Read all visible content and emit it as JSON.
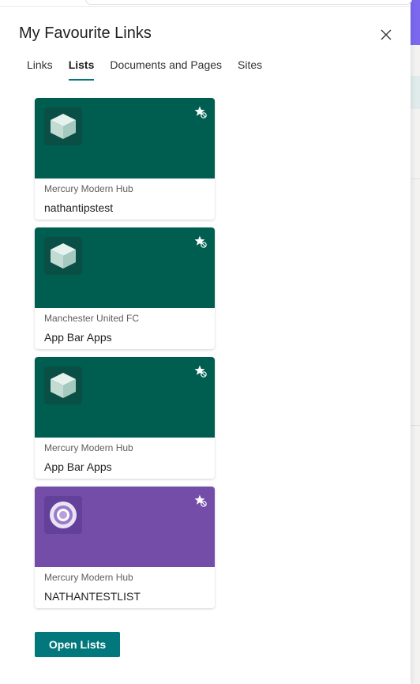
{
  "panel": {
    "title": "My Favourite Links",
    "close_label": "close"
  },
  "tabs": [
    {
      "label": "Links",
      "active": false
    },
    {
      "label": "Lists",
      "active": true
    },
    {
      "label": "Documents and Pages",
      "active": false
    },
    {
      "label": "Sites",
      "active": false
    }
  ],
  "cards": [
    {
      "site": "Mercury Modern Hub",
      "name": "nathantipstest",
      "color": "#005e50",
      "icon": "cube-icon"
    },
    {
      "site": "Manchester United FC",
      "name": "App Bar Apps",
      "color": "#005e50",
      "icon": "cube-icon"
    },
    {
      "site": "Mercury Modern Hub",
      "name": "App Bar Apps",
      "color": "#005e50",
      "icon": "cube-icon"
    },
    {
      "site": "Mercury Modern Hub",
      "name": "NATHANTESTLIST",
      "color": "#744da9",
      "icon": "target-icon"
    }
  ],
  "open_button": {
    "label": "Open Lists"
  },
  "colors": {
    "accent": "#03787c",
    "teal_banner": "#005e50",
    "purple_banner": "#744da9"
  }
}
